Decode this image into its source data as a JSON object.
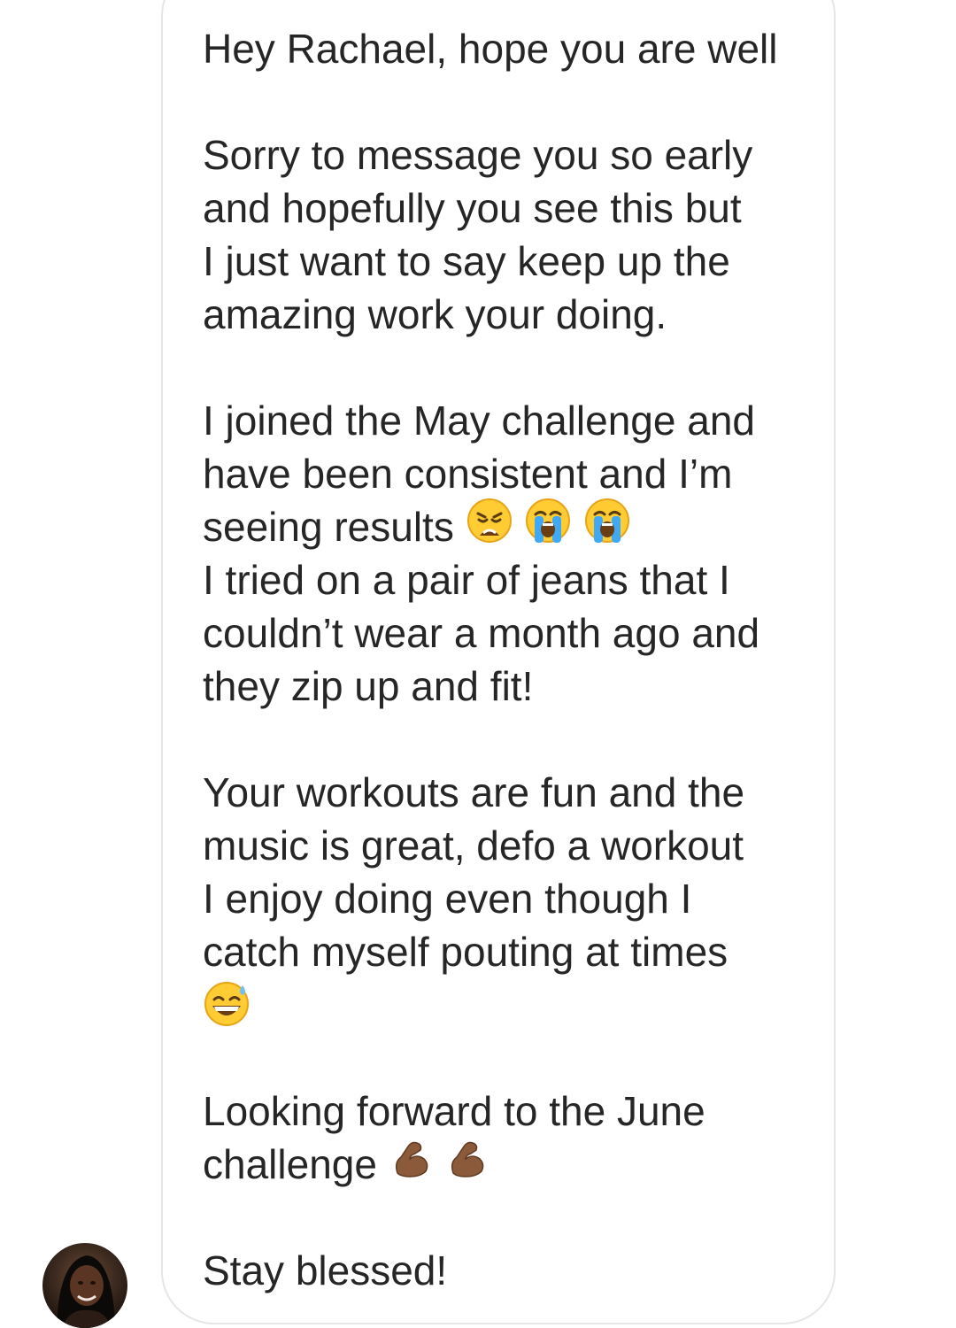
{
  "message": {
    "lines": [
      "Hey Rachael, hope you are well",
      "Sorry to message you so early",
      "and hopefully you see this but",
      "I just want to say keep up the",
      "amazing work your doing.",
      "I joined the May challenge and",
      "have been consistent and I’m",
      "seeing results",
      "I tried on a pair of jeans that I",
      "couldn’t wear a month ago and",
      "they zip up and fit!",
      "Your workouts are fun and the",
      "music is great, defo a workout",
      "I enjoy doing even though I",
      "catch myself pouting at times",
      "Looking forward to the June",
      "challenge",
      "Stay blessed!"
    ],
    "emojis": {
      "results": [
        "weary-face",
        "loudly-crying-face",
        "loudly-crying-face"
      ],
      "pouting": [
        "grinning-face-with-sweat"
      ],
      "challenge": [
        "flexed-biceps",
        "flexed-biceps"
      ]
    }
  },
  "colors": {
    "text": "#262626",
    "bubble_border": "#e6e6e6",
    "background": "#ffffff"
  }
}
